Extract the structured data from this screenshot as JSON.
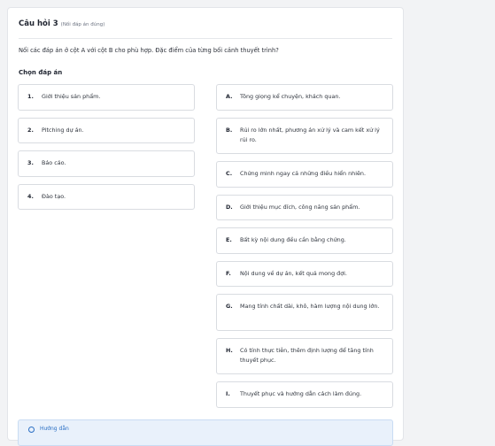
{
  "question": {
    "title": "Câu hỏi 3",
    "hint": "(Nối đáp án đúng)",
    "instruction": "Nối các đáp án ở cột A với cột B cho phù hợp. Đặc điểm của từng bối cảnh thuyết trình?",
    "choose_label": "Chọn đáp án"
  },
  "column_a": [
    {
      "key": "1.",
      "text": "Giới thiệu sản phẩm."
    },
    {
      "key": "2.",
      "text": "Pitching dự án."
    },
    {
      "key": "3.",
      "text": "Báo cáo."
    },
    {
      "key": "4.",
      "text": "Đào tạo."
    }
  ],
  "column_b": [
    {
      "key": "A.",
      "text": "Tông giọng kể chuyện, khách quan."
    },
    {
      "key": "B.",
      "text": "Rủi ro lớn nhất, phương án xử lý và cam kết xử lý rủi ro."
    },
    {
      "key": "C.",
      "text": "Chứng minh ngay cả những điều hiển nhiên."
    },
    {
      "key": "D.",
      "text": "Giới thiệu mục đích, công năng sản phẩm."
    },
    {
      "key": "E.",
      "text": "Bất kỳ nội dung đều cần bằng chứng."
    },
    {
      "key": "F.",
      "text": "Nội dung về dự án, kết quả mong đợi."
    },
    {
      "key": "G.",
      "text": "Mang tính chất dài, khô, hàm lượng nội dung lớn."
    },
    {
      "key": "H.",
      "text": "Có tính thực tiễn, thêm định lượng để tăng tính thuyết phục."
    },
    {
      "key": "I.",
      "text": "Thuyết phục và hướng dẫn cách làm đúng."
    }
  ],
  "guide": {
    "label": "Hướng dẫn",
    "icon": "info-icon"
  }
}
